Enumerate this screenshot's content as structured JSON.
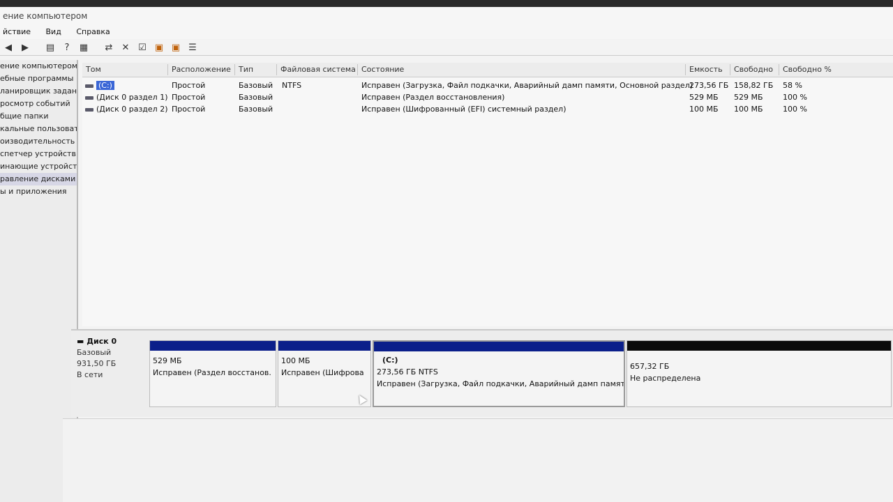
{
  "window": {
    "title": "ение компьютером"
  },
  "menu": {
    "items": [
      "йствие",
      "Вид",
      "Справка"
    ]
  },
  "toolbar": {
    "icons": [
      "back-icon",
      "forward-icon",
      "show-hide-tree-icon",
      "help-icon",
      "panel-icon",
      "connect-icon",
      "delete-icon",
      "properties-icon",
      "import-icon",
      "export-icon",
      "view-icon"
    ]
  },
  "tree": {
    "items": [
      "ение компьютером (лс",
      "ебные программы",
      "ланировщик заданий",
      "росмотр событий",
      "бщие папки",
      "кальные пользовате",
      "оизводительность",
      "спетчер устройств",
      "инающие устройства",
      "равление дисками",
      "ы и приложения"
    ],
    "selected_index": 9
  },
  "volumes": {
    "columns": {
      "tom": "Том",
      "location": "Расположение",
      "type": "Тип",
      "fs": "Файловая система",
      "status": "Состояние",
      "capacity": "Емкость",
      "free": "Свободно",
      "free_pct": "Свободно %"
    },
    "rows": [
      {
        "name": "(C:)",
        "location": "Простой",
        "type": "Базовый",
        "fs": "NTFS",
        "status": "Исправен (Загрузка, Файл подкачки, Аварийный дамп памяти, Основной раздел)",
        "capacity": "273,56 ГБ",
        "free": "158,82 ГБ",
        "free_pct": "58 %"
      },
      {
        "name": "(Диск 0 раздел 1)",
        "location": "Простой",
        "type": "Базовый",
        "fs": "",
        "status": "Исправен (Раздел восстановления)",
        "capacity": "529 МБ",
        "free": "529 МБ",
        "free_pct": "100 %"
      },
      {
        "name": "(Диск 0 раздел 2)",
        "location": "Простой",
        "type": "Базовый",
        "fs": "",
        "status": "Исправен (Шифрованный (EFI) системный раздел)",
        "capacity": "100 МБ",
        "free": "100 МБ",
        "free_pct": "100 %"
      }
    ]
  },
  "disk": {
    "title": "Диск 0",
    "type": "Базовый",
    "size": "931,50 ГБ",
    "state": "В сети",
    "partitions": [
      {
        "label": "",
        "size": "529 МБ",
        "status": "Исправен (Раздел восстанов."
      },
      {
        "label": "",
        "size": "100 МБ",
        "status": "Исправен (Шифрова"
      },
      {
        "label": "(C:)",
        "size": "273,56 ГБ NTFS",
        "status": "Исправен (Загрузка, Файл подкачки, Аварийный дамп памят"
      },
      {
        "label": "",
        "size": "657,32 ГБ",
        "status": "Не распределена"
      }
    ]
  },
  "colors": {
    "primary_partition": "#0b1f8a",
    "unallocated": "#0a0a0a",
    "selection": "#3a66d6"
  }
}
